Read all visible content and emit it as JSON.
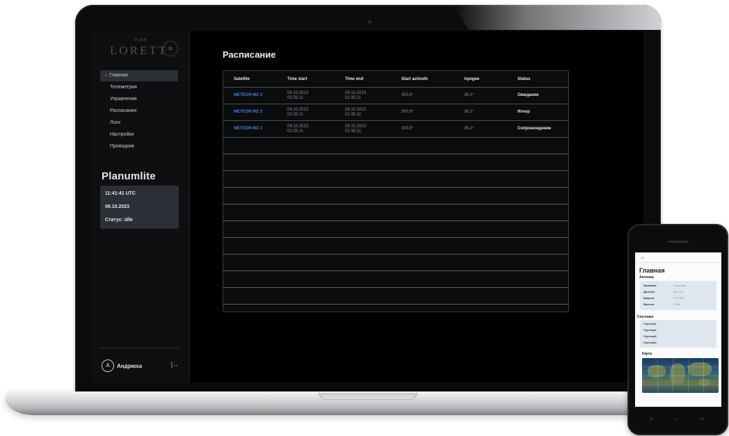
{
  "app": {
    "logo_text": "LORETT",
    "logo_sub": "PLAN",
    "theme_icon": "sun-icon",
    "nav": [
      {
        "label": "Главная",
        "active": true
      },
      {
        "label": "Телеметрия"
      },
      {
        "label": "Управление"
      },
      {
        "label": "Расписание"
      },
      {
        "label": "Логи"
      },
      {
        "label": "Настройки"
      },
      {
        "label": "Проводник"
      }
    ],
    "station_name": "Planumlite",
    "info": {
      "time": "11:41:41 UTC",
      "date": "08.10.2023",
      "status": "Статус: idle"
    },
    "user": {
      "avatar_letter": "A",
      "name": "Андрюха",
      "logout_icon": "logout-icon"
    }
  },
  "schedule": {
    "title": "Расписание",
    "columns": [
      "Satellite",
      "Time start",
      "Time end",
      "Start azimuth",
      "Apogee",
      "Status"
    ],
    "rows": [
      {
        "satellite": "METEOR-M2 3",
        "start_date": "09.10.2023",
        "start_time": "02:35:11",
        "end_date": "09.10.2023",
        "end_time": "02:35:11",
        "azimuth": "300.9°",
        "apogee": "36.2°",
        "status": "Ожидание"
      },
      {
        "satellite": "METEOR-M2 3",
        "start_date": "09.10.2023",
        "start_time": "02:35:11",
        "end_date": "09.10.2023",
        "end_time": "02:35:11",
        "azimuth": "300.9°",
        "apogee": "36.2°",
        "status": "Игнор"
      },
      {
        "satellite": "METEOR-M2 3",
        "start_date": "09.10.2023",
        "start_time": "02:35:11",
        "end_date": "09.10.2023",
        "end_time": "02:35:11",
        "azimuth": "300.9°",
        "apogee": "36.2°",
        "status": "Сопровождение"
      }
    ]
  },
  "phone": {
    "menu_icon": "close-icon",
    "title": "Главная",
    "antenna_label": "Антенна",
    "antenna_rows": [
      {
        "k": "Название",
        "v": "Planumlite"
      },
      {
        "k": "Долгота",
        "v": "60.1713"
      },
      {
        "k": "Широта",
        "v": "37.5798"
      },
      {
        "k": "Высота",
        "v": "120м"
      }
    ],
    "satellites_label": "Спутники",
    "satellites": [
      "Спутник1",
      "Спутник2",
      "Спутник3",
      "Спутник4"
    ],
    "map_label": "Карта"
  }
}
